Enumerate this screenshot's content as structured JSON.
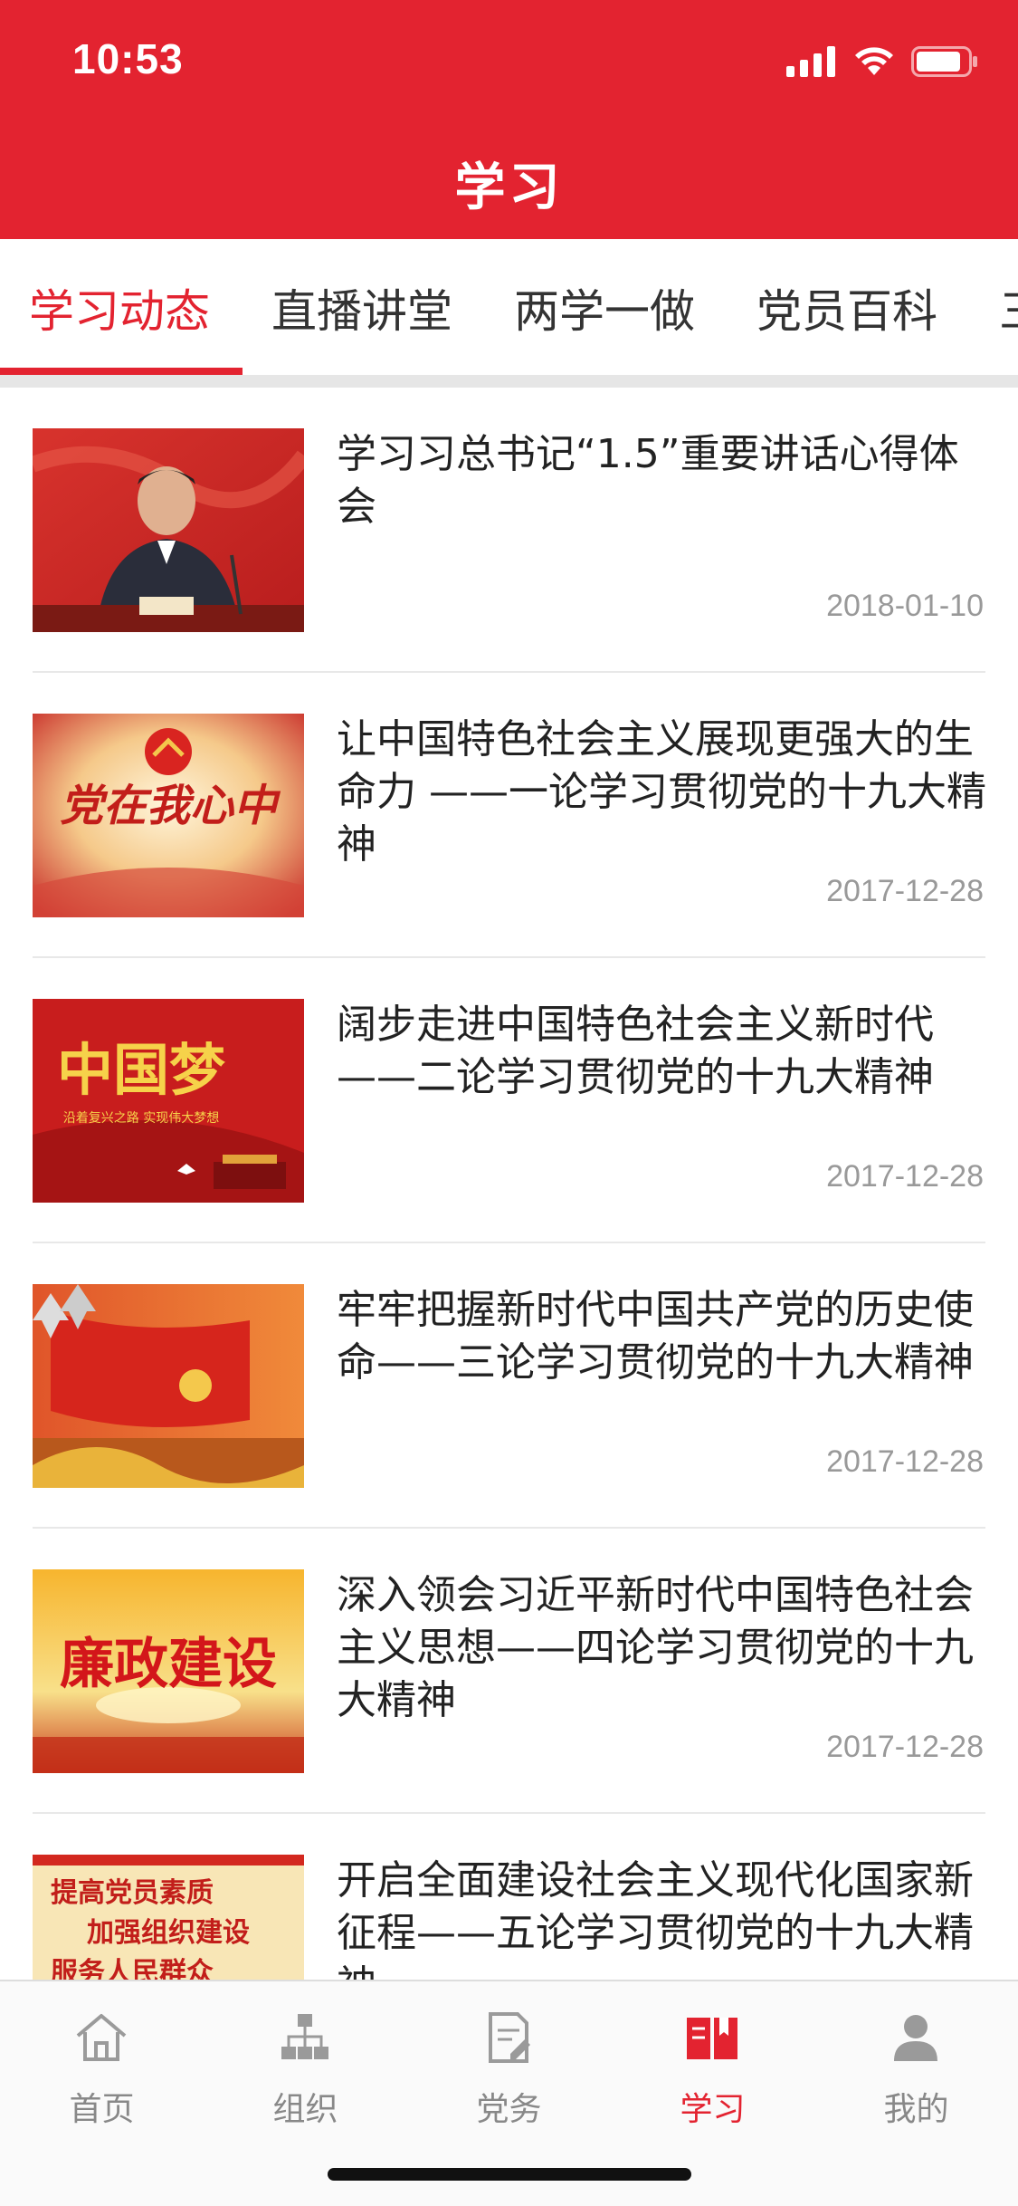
{
  "status_bar": {
    "time": "10:53"
  },
  "header": {
    "title": "学习"
  },
  "tabs": [
    {
      "label": "学习动态",
      "active": true
    },
    {
      "label": "直播讲堂",
      "active": false
    },
    {
      "label": "两学一做",
      "active": false
    },
    {
      "label": "党员百科",
      "active": false
    },
    {
      "label": "三",
      "active": false
    }
  ],
  "articles": [
    {
      "title": "学习习总书记“1.5”重要讲话心得体会",
      "date": "2018-01-10"
    },
    {
      "title": "让中国特色社会主义展现更强大的生命力 ——一论学习贯彻党的十九大精神",
      "date": "2017-12-28"
    },
    {
      "title": "阔步走进中国特色社会主义新时代——二论学习贯彻党的十九大精神",
      "date": "2017-12-28"
    },
    {
      "title": "牢牢把握新时代中国共产党的历史使命——三论学习贯彻党的十九大精神",
      "date": "2017-12-28"
    },
    {
      "title": "深入领会习近平新时代中国特色社会主义思想——四论学习贯彻党的十九大精神",
      "date": "2017-12-28"
    },
    {
      "title": "开启全面建设社会主义现代化国家新征程——五论学习贯彻党的十九大精神",
      "date": ""
    }
  ],
  "thumb_text": {
    "t2": "党在我心中",
    "t3_main": "中国梦",
    "t3_sub": "沿着复兴之路  实现伟大梦想",
    "t5": "廉政建设",
    "t6_line1": "提高党员素质",
    "t6_line2": "加强组织建设",
    "t6_line3": "服务人民群众"
  },
  "bottom_nav": [
    {
      "label": "首页",
      "icon": "home-icon",
      "active": false
    },
    {
      "label": "组织",
      "icon": "org-icon",
      "active": false
    },
    {
      "label": "党务",
      "icon": "document-icon",
      "active": false
    },
    {
      "label": "学习",
      "icon": "book-icon",
      "active": true
    },
    {
      "label": "我的",
      "icon": "user-icon",
      "active": false
    }
  ],
  "colors": {
    "brand": "#e32330",
    "inactive": "#888888",
    "date": "#999999"
  }
}
